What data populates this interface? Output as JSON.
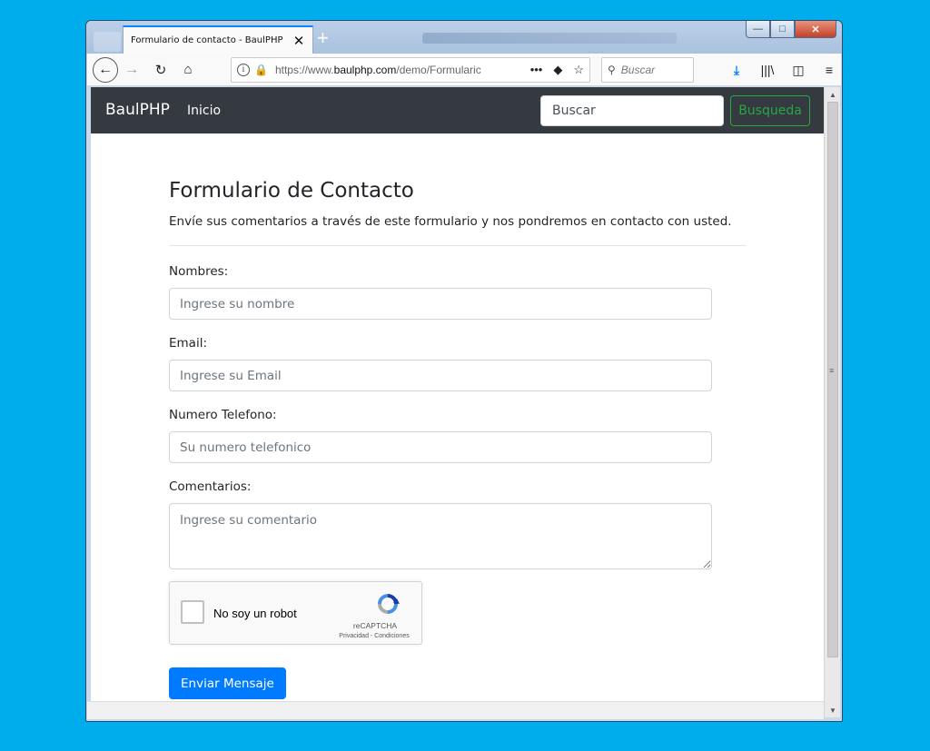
{
  "browser": {
    "tab_title": "Formulario de contacto - BaulPHP",
    "tab_close": "✕",
    "new_tab": "+",
    "url_prefix": "https://www.",
    "url_domain": "baulphp.com",
    "url_path": "/demo/Formularic",
    "search_placeholder": "Buscar",
    "controls": {
      "minimize": "—",
      "maximize": "□",
      "close": "✕"
    },
    "icons": {
      "back": "←",
      "forward": "→",
      "reload": "↻",
      "home": "⌂",
      "info": "i",
      "lock": "🔒",
      "more": "•••",
      "pocket": "◆",
      "bookmark": "☆",
      "search": "⚲",
      "download": "⤓",
      "library": "|||\\",
      "sidebar": "◫",
      "menu": "≡"
    }
  },
  "site": {
    "brand": "BaulPHP",
    "nav_home": "Inicio",
    "search_placeholder": "Buscar",
    "search_button": "Busqueda"
  },
  "form": {
    "title": "Formulario de Contacto",
    "lead": "Envíe sus comentarios a través de este formulario y nos pondremos en contacto con usted.",
    "name_label": "Nombres:",
    "name_placeholder": "Ingrese su nombre",
    "email_label": "Email:",
    "email_placeholder": "Ingrese su Email",
    "phone_label": "Numero Telefono:",
    "phone_placeholder": "Su numero telefonico",
    "comments_label": "Comentarios:",
    "comments_placeholder": "Ingrese su comentario",
    "submit_label": "Enviar Mensaje"
  },
  "recaptcha": {
    "label": "No soy un robot",
    "brand": "reCAPTCHA",
    "terms": "Privacidad - Condiciones"
  },
  "colors": {
    "desktop": "#00adec",
    "navbar": "#343a40",
    "primary": "#007bff",
    "success": "#28a745"
  }
}
